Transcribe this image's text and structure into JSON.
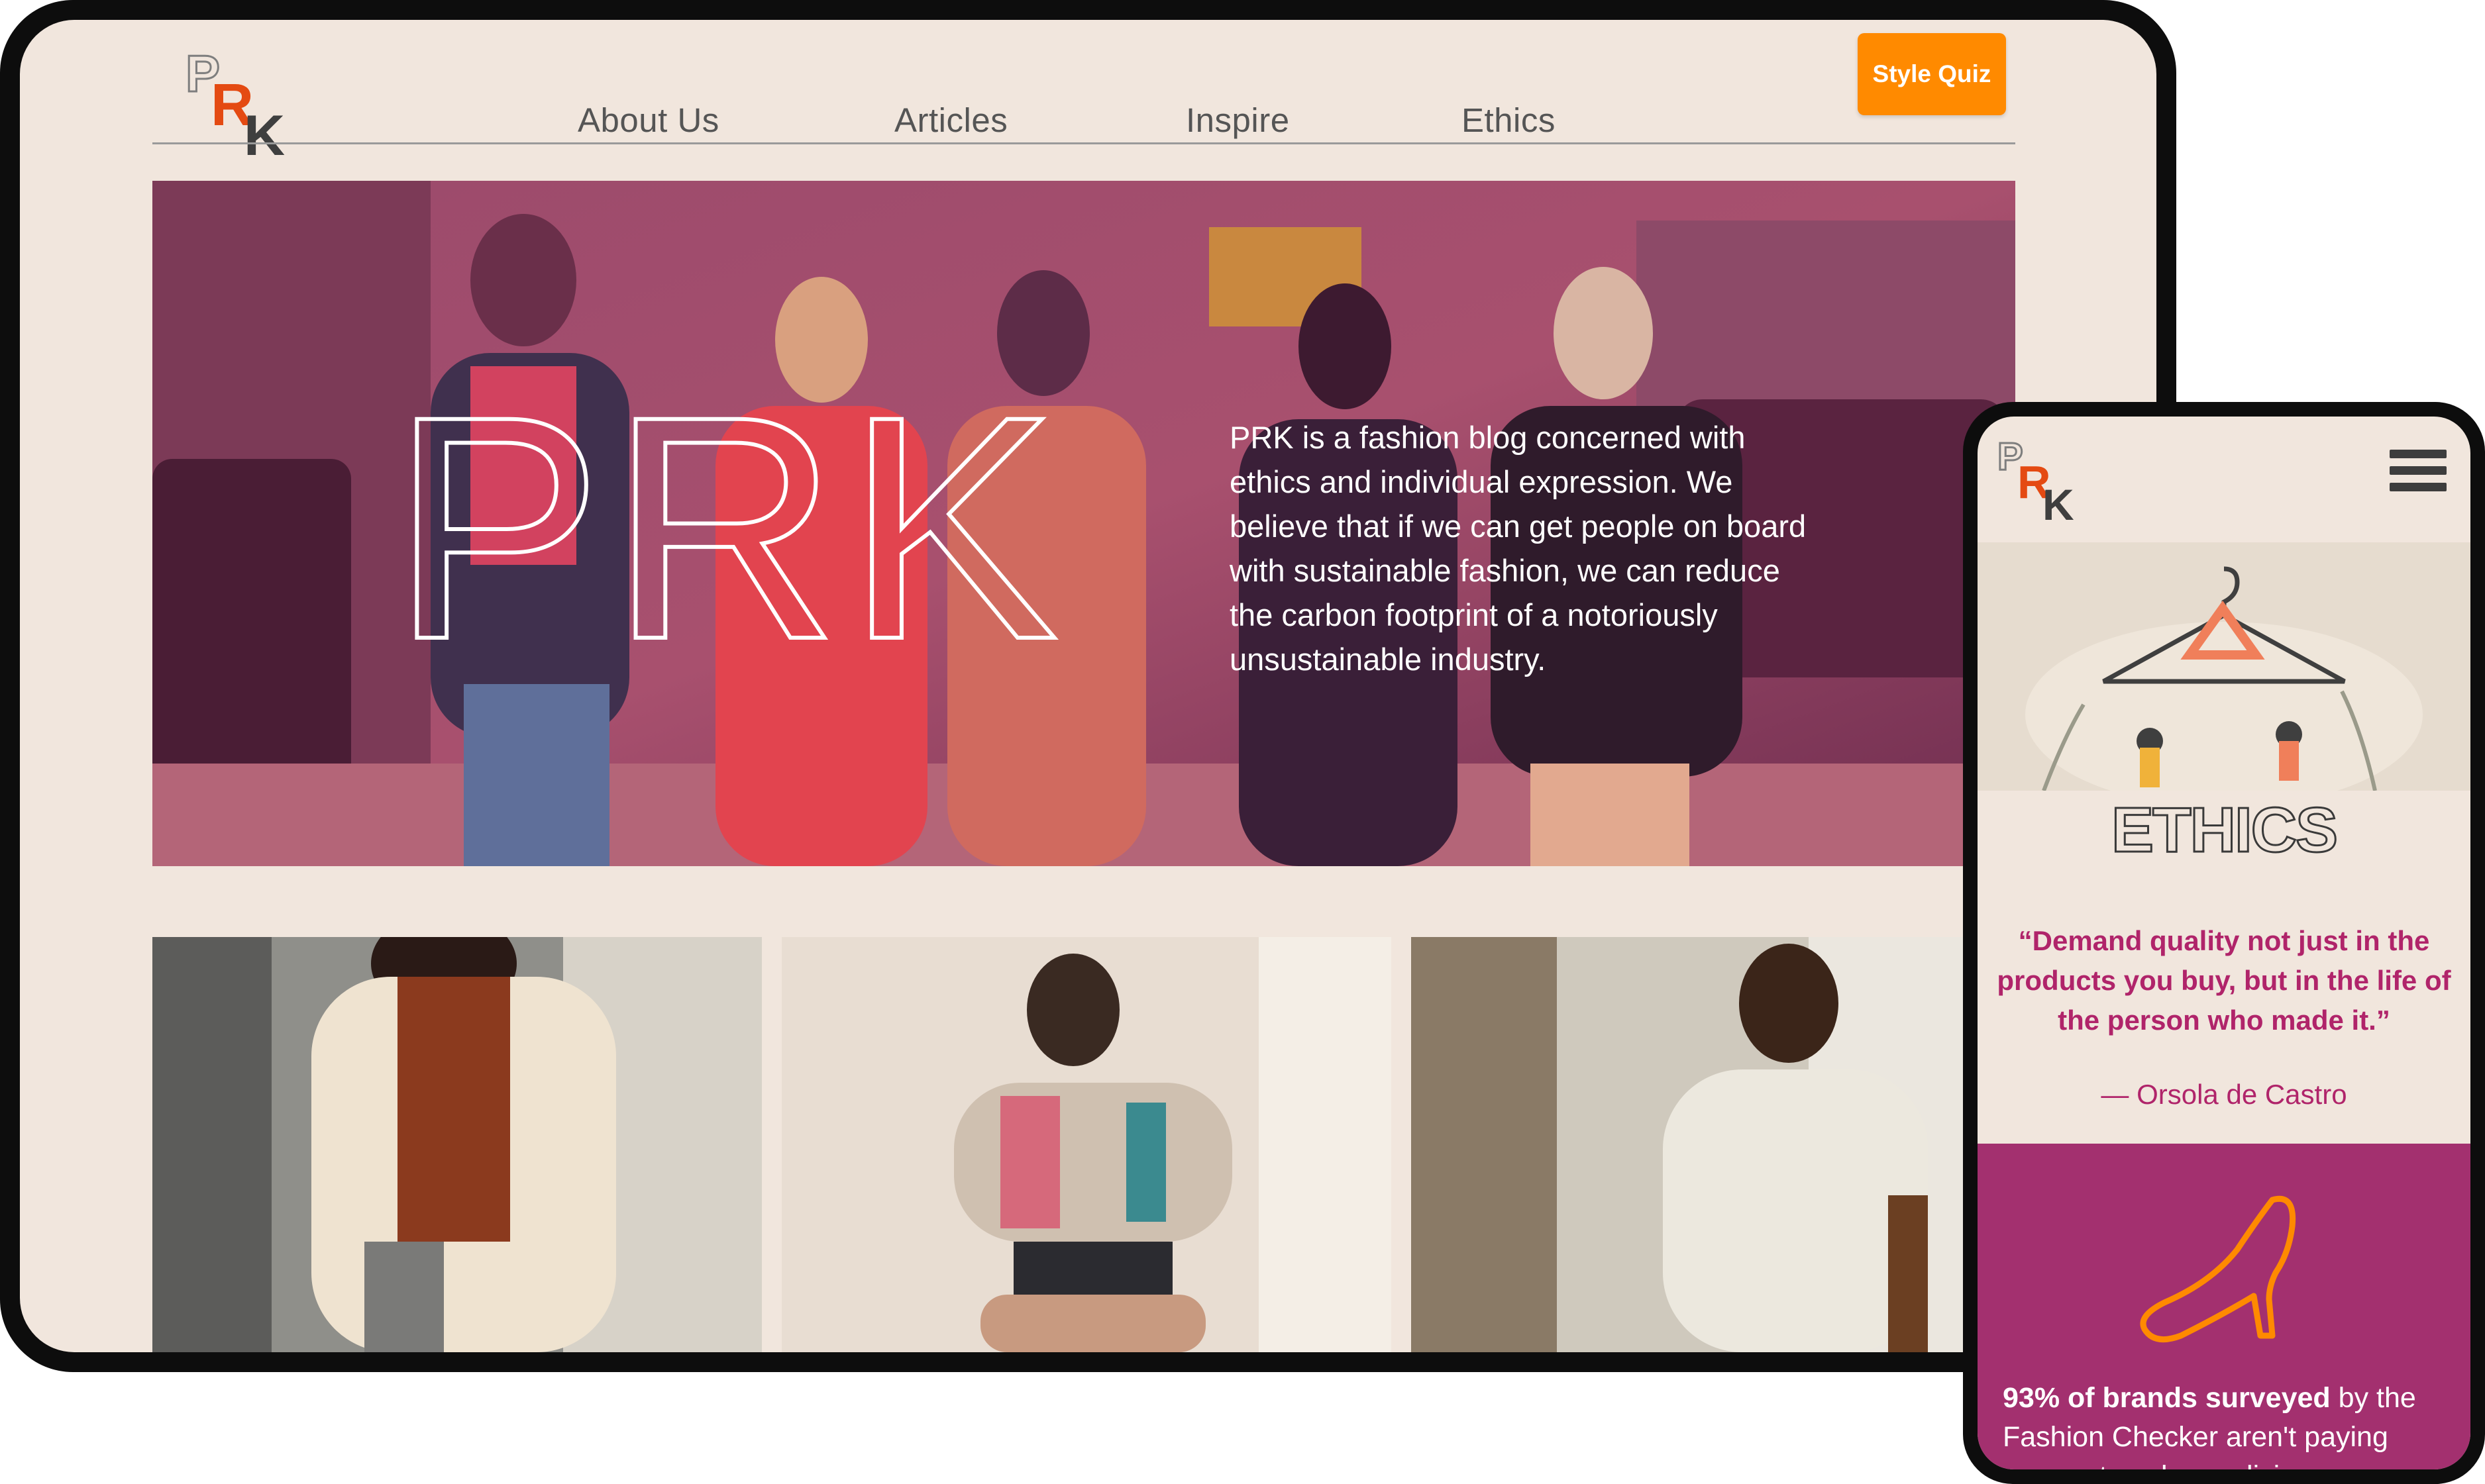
{
  "tablet": {
    "logo": {
      "p": "P",
      "r": "R",
      "k": "K"
    },
    "nav": [
      {
        "label": "About Us"
      },
      {
        "label": "Articles"
      },
      {
        "label": "Inspire"
      },
      {
        "label": "Ethics"
      }
    ],
    "quiz_button": "Style Quiz",
    "hero": {
      "wordmark": "PRK",
      "text": "PRK is a fashion blog concerned with ethics and individual expression. We believe that if we can get people on board with sustainable fashion, we can reduce the carbon footprint of a notoriously unsustainable industry."
    }
  },
  "phone": {
    "logo": {
      "p": "P",
      "r": "R",
      "k": "K"
    },
    "menu_icon": "hamburger-menu-icon",
    "title": "ETHICS",
    "quote": "“Demand quality not just in the products you buy, but in the life of the person who made it.”",
    "quote_author": "— Orsola de Castro",
    "stat_icon": "high-heel-icon",
    "stat_bold": "93% of brands surveyed",
    "stat_rest": " by the Fashion Checker aren't paying garment workers a living wage"
  },
  "colors": {
    "background": "#f1e6dd",
    "accent_orange": "#ff8a00",
    "accent_magenta": "#a3306f",
    "logo_red": "#e44a12"
  }
}
